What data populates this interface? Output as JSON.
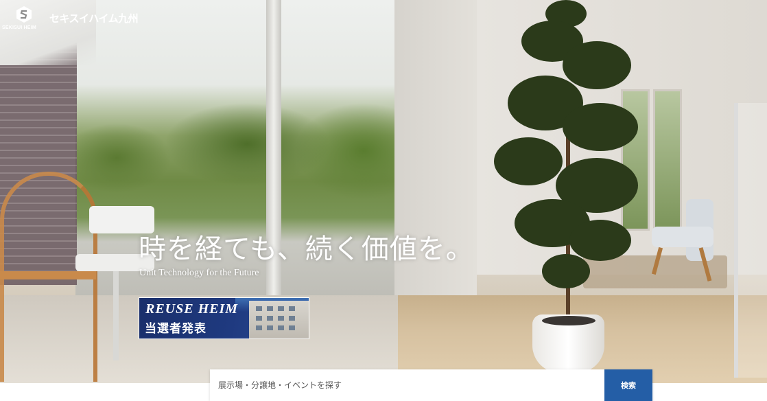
{
  "brand": {
    "logo_sub": "SEKISUI HEIM",
    "name": "セキスイハイム九州"
  },
  "hero": {
    "headline": "時を経ても、続く価値を。",
    "subline": "Unit Technology for the Future"
  },
  "banner": {
    "title_en": "REUSE HEIM",
    "title_jp": "当選者発表"
  },
  "search": {
    "placeholder": "展示場・分譲地・イベントを探す",
    "button_label": "検索"
  },
  "colors": {
    "accent": "#245ea6",
    "banner_bg": "#1f3a80"
  }
}
